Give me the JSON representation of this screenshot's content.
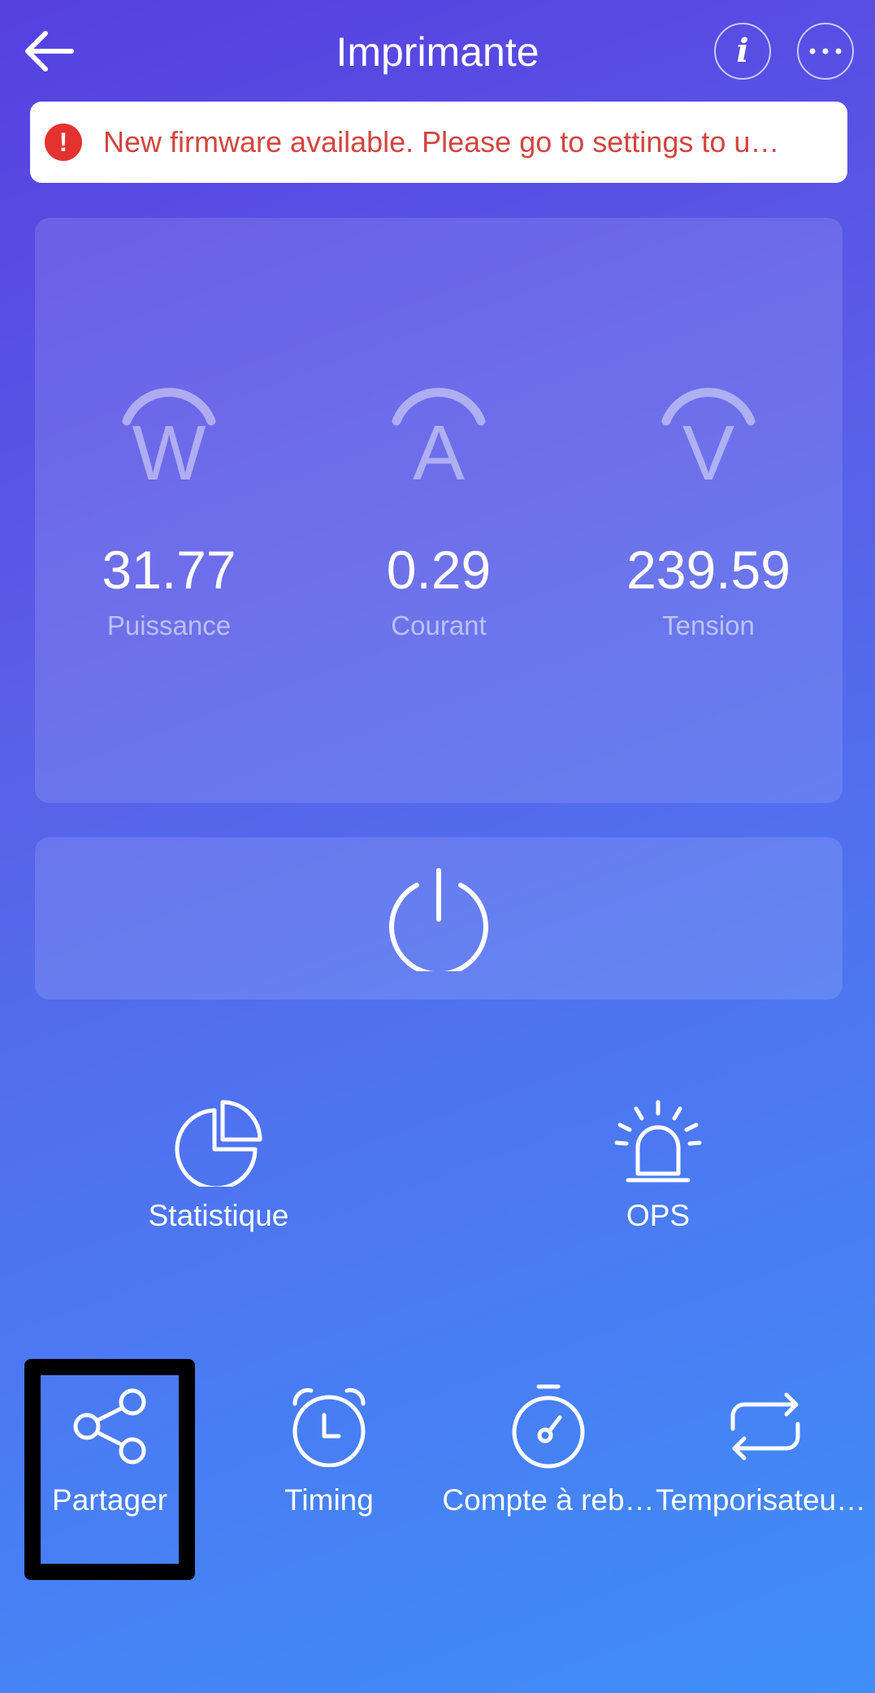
{
  "header": {
    "title": "Imprimante"
  },
  "banner": {
    "text": "New firmware available. Please go to settings to u…"
  },
  "metrics": [
    {
      "value": "31.77",
      "label": "Puissance",
      "icon": "watt-icon",
      "letter": "W"
    },
    {
      "value": "0.29",
      "label": "Courant",
      "icon": "ampere-icon",
      "letter": "A"
    },
    {
      "value": "239.59",
      "label": "Tension",
      "icon": "volt-icon",
      "letter": "V"
    }
  ],
  "features": [
    {
      "label": "Statistique",
      "icon": "pie-chart-icon"
    },
    {
      "label": "OPS",
      "icon": "siren-icon"
    }
  ],
  "tabs": [
    {
      "label": "Partager",
      "icon": "share-icon"
    },
    {
      "label": "Timing",
      "icon": "alarm-clock-icon"
    },
    {
      "label": "Compte à reb…",
      "icon": "stopwatch-icon"
    },
    {
      "label": "Temporisateur…",
      "icon": "repeat-icon"
    }
  ],
  "colors": {
    "alert": "#e3322f",
    "banner_text": "#d2453f",
    "highlight": "#000000"
  }
}
